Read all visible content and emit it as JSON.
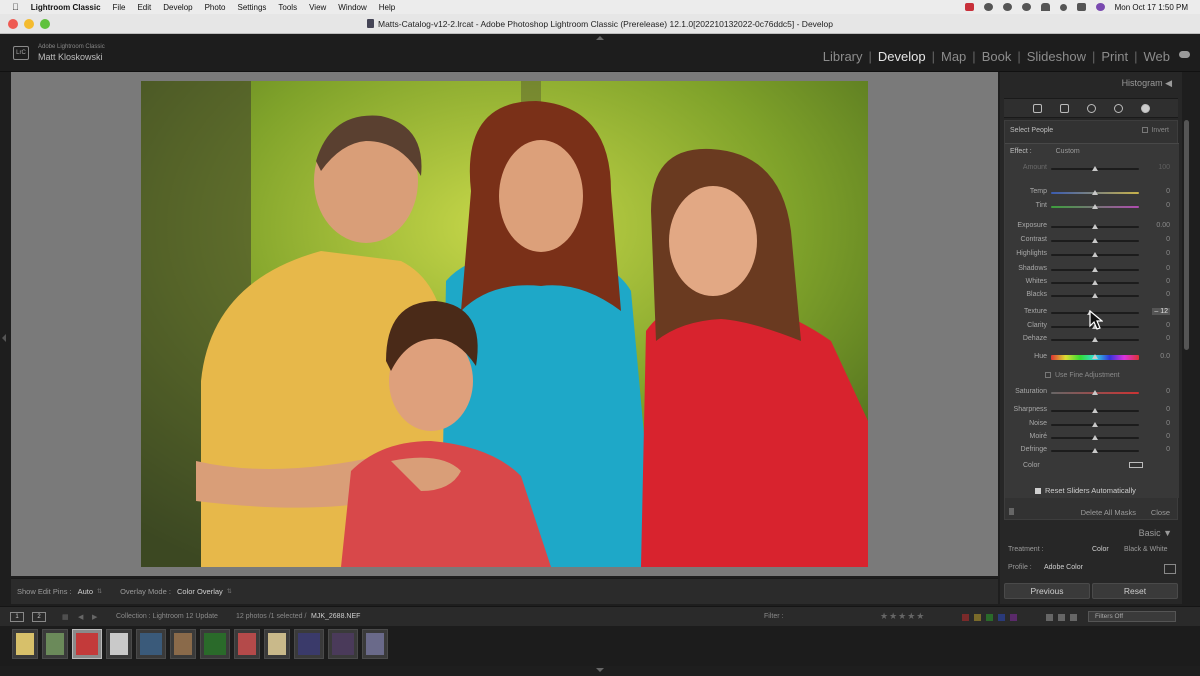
{
  "menubar": {
    "app": "Lightroom Classic",
    "items": [
      "File",
      "Edit",
      "Develop",
      "Photo",
      "Settings",
      "Tools",
      "View",
      "Window",
      "Help"
    ],
    "clock": "Mon Oct 17  1:50 PM"
  },
  "window": {
    "title": "Matts-Catalog-v12-2.lrcat - Adobe Photoshop Lightroom Classic (Prerelease) 12.1.0[202210132022-0c76ddc5] - Develop"
  },
  "identity": {
    "logo": "LrC",
    "product": "Adobe Lightroom Classic",
    "user": "Matt Kloskowski"
  },
  "modules": {
    "items": [
      "Library",
      "Develop",
      "Map",
      "Book",
      "Slideshow",
      "Print",
      "Web"
    ],
    "active": "Develop"
  },
  "toolbar": {
    "edit_pins_label": "Show Edit Pins :",
    "edit_pins_value": "Auto",
    "overlay_label": "Overlay Mode :",
    "overlay_value": "Color Overlay"
  },
  "right_panel": {
    "histogram_title": "Histogram",
    "mask_name": "Select People",
    "invert_label": "Invert",
    "effect_label": "Effect :",
    "effect_value": "Custom",
    "amount_label": "Amount",
    "amount_value": "100",
    "sliders": [
      {
        "label": "Temp",
        "value": "0",
        "pos": 0.5,
        "kind": "temp"
      },
      {
        "label": "Tint",
        "value": "0",
        "pos": 0.5,
        "kind": "tint"
      },
      {
        "label": "Exposure",
        "value": "0.00",
        "pos": 0.5
      },
      {
        "label": "Contrast",
        "value": "0",
        "pos": 0.5
      },
      {
        "label": "Highlights",
        "value": "0",
        "pos": 0.5
      },
      {
        "label": "Shadows",
        "value": "0",
        "pos": 0.5
      },
      {
        "label": "Whites",
        "value": "0",
        "pos": 0.5
      },
      {
        "label": "Blacks",
        "value": "0",
        "pos": 0.5
      },
      {
        "label": "Texture",
        "value": "– 12",
        "pos": 0.44,
        "highlight": true
      },
      {
        "label": "Clarity",
        "value": "0",
        "pos": 0.5
      },
      {
        "label": "Dehaze",
        "value": "0",
        "pos": 0.5
      },
      {
        "label": "Hue",
        "value": "0.0",
        "pos": 0.5,
        "kind": "hue"
      },
      {
        "label": "Saturation",
        "value": "0",
        "pos": 0.5,
        "kind": "sat"
      },
      {
        "label": "Sharpness",
        "value": "0",
        "pos": 0.5
      },
      {
        "label": "Noise",
        "value": "0",
        "pos": 0.5
      },
      {
        "label": "Moiré",
        "value": "0",
        "pos": 0.5
      },
      {
        "label": "Defringe",
        "value": "0",
        "pos": 0.5
      }
    ],
    "fine_adjustment_label": "Use Fine Adjustment",
    "color_label": "Color",
    "reset_sliders_label": "Reset Sliders Automatically",
    "delete_all_masks": "Delete All Masks",
    "close_label": "Close",
    "basic_title": "Basic",
    "treatment_label": "Treatment :",
    "treatment_color": "Color",
    "treatment_bw": "Black & White",
    "profile_label": "Profile :",
    "profile_value": "Adobe Color",
    "previous_button": "Previous",
    "reset_button": "Reset"
  },
  "filmbar": {
    "view1": "1",
    "view2": "2",
    "collection": "Collection : Lightroom 12 Update",
    "count": "12 photos /1 selected /",
    "filename": "MJK_2688.NEF",
    "filter_label": "Filter :",
    "filters_off": "Filters Off"
  },
  "filmstrip": {
    "selected_index": 2,
    "thumbs": [
      {
        "w": 26,
        "color": "#d7c06a"
      },
      {
        "w": 26,
        "color": "#6b8a5a"
      },
      {
        "w": 30,
        "color": "#c33a3a"
      },
      {
        "w": 26,
        "color": "#c9c9c9"
      },
      {
        "w": 30,
        "color": "#3a5a7a"
      },
      {
        "w": 26,
        "color": "#8a6a4a"
      },
      {
        "w": 30,
        "color": "#2a6a2a"
      },
      {
        "w": 26,
        "color": "#b44a4a"
      },
      {
        "w": 26,
        "color": "#c9b98a"
      },
      {
        "w": 30,
        "color": "#3a3a6a"
      },
      {
        "w": 30,
        "color": "#4a3a5a"
      },
      {
        "w": 26,
        "color": "#6a6a8a"
      }
    ]
  },
  "colors": {
    "accent": "#e6e6e6",
    "panel": "#272727",
    "photo_bg": "#7a7a7a"
  }
}
